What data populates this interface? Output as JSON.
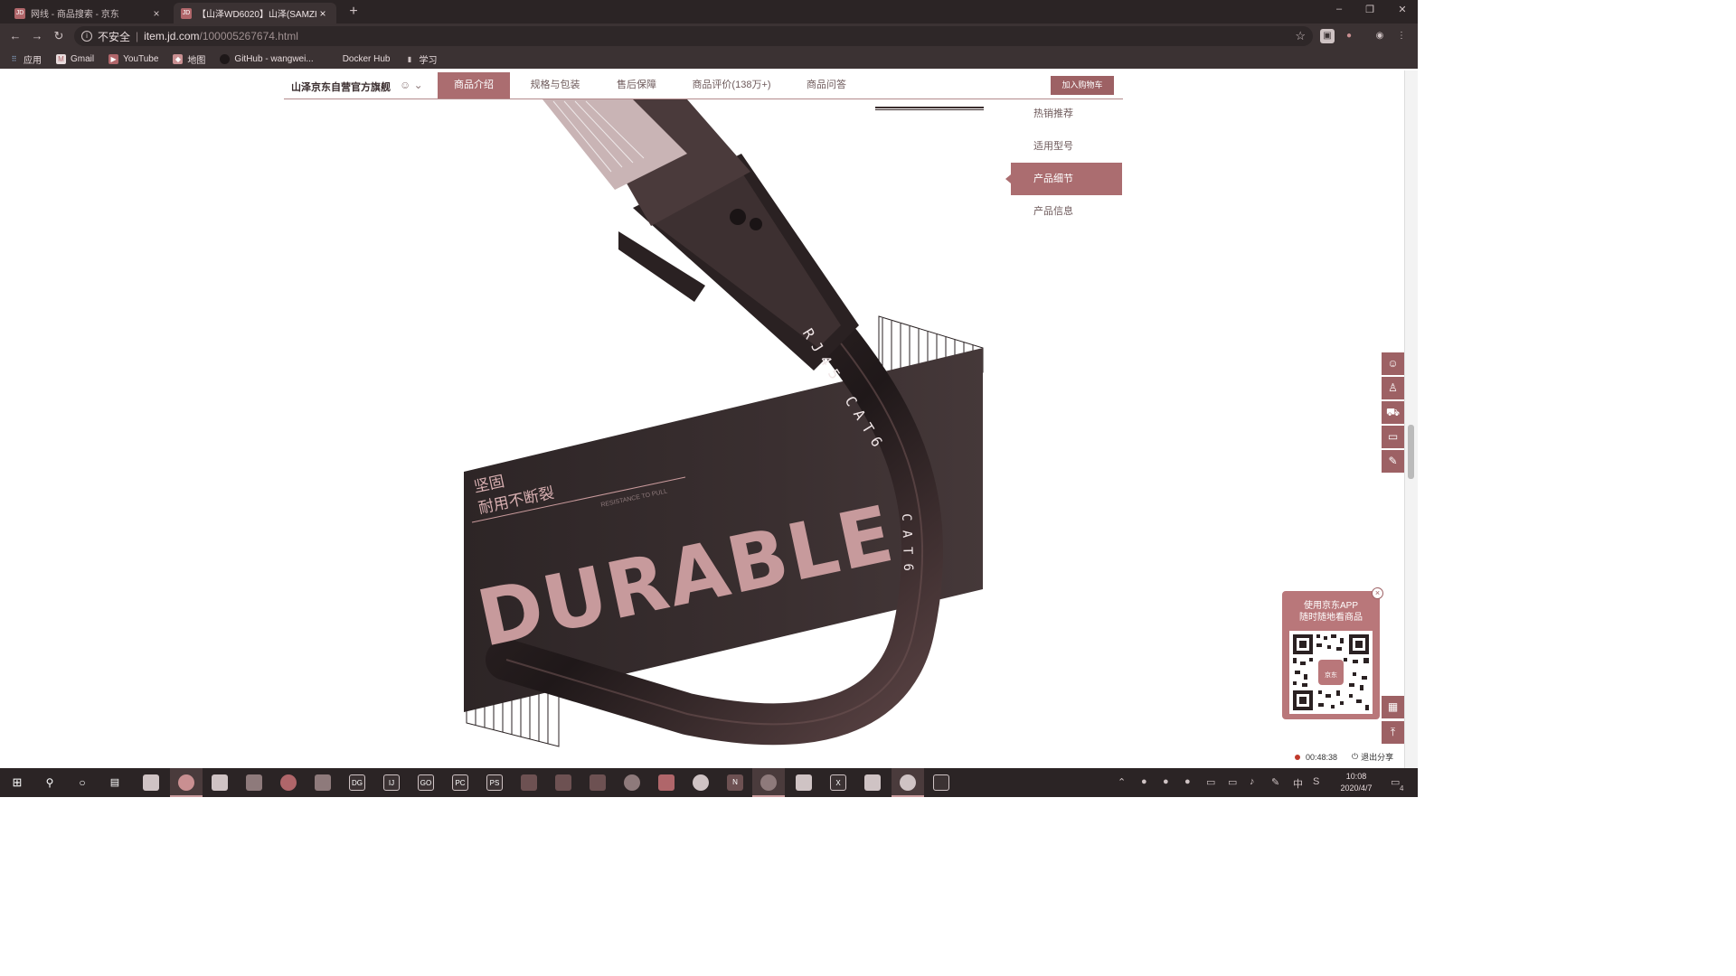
{
  "browser": {
    "tabs": [
      {
        "favicon": "JD",
        "title": "网线 - 商品搜索 - 京东",
        "close": "×"
      },
      {
        "favicon": "JD",
        "title": "【山泽WD6020】山泽(SAMZHI",
        "close": "×"
      }
    ],
    "new_tab": "+",
    "window_controls": {
      "minimize": "–",
      "maximize": "❐",
      "close": "✕"
    },
    "nav": {
      "back": "←",
      "forward": "→",
      "reload": "↻"
    },
    "address": {
      "security": "不安全",
      "separator": "|",
      "host": "item.jd.com",
      "path": "/100005267674.html",
      "star": "☆"
    },
    "bookmarks": [
      {
        "label": "应用",
        "icon": "apps-grid-icon"
      },
      {
        "label": "Gmail",
        "icon": "gmail-icon"
      },
      {
        "label": "YouTube",
        "icon": "youtube-icon"
      },
      {
        "label": "地图",
        "icon": "maps-icon"
      },
      {
        "label": "GitHub - wangwei...",
        "icon": "github-icon"
      },
      {
        "label": "Docker Hub",
        "icon": "docker-icon"
      },
      {
        "label": "学习",
        "icon": "folder-icon"
      }
    ]
  },
  "product_nav": {
    "shop_name": "山泽京东自营官方旗舰",
    "chat": "☺ ⌄",
    "tabs": [
      "商品介绍",
      "规格与包装",
      "售后保障",
      "商品评价(138万+)",
      "商品问答"
    ],
    "active_tab": "商品介绍",
    "add_to_cart": "加入购物车"
  },
  "side_menu": {
    "items": [
      "热销推荐",
      "适用型号",
      "产品细节",
      "产品信息"
    ],
    "active": "产品细节"
  },
  "hero": {
    "headline_1": "坚固",
    "headline_2": "耐用不断裂",
    "small_caption": "RESISTANCE TO PULL",
    "big_word": "DURABLE",
    "cable_print_1": "RJ45 CAT6",
    "cable_print_2": "CAT6"
  },
  "app_promo": {
    "line1": "使用京东APP",
    "line2": "随时随地看商品",
    "qr_caption": "京东",
    "close": "×"
  },
  "recording": {
    "time": "00:48:38",
    "stop": "退出分享"
  },
  "taskbar": {
    "clock_time": "10:08",
    "clock_date": "2020/4/7",
    "tray_lang": "中",
    "notification_count": "4"
  },
  "colors": {
    "accent": "#ab6d70",
    "accent_dark": "#9d6164",
    "chrome_dark": "#2b2425",
    "chrome": "#3b3233"
  }
}
